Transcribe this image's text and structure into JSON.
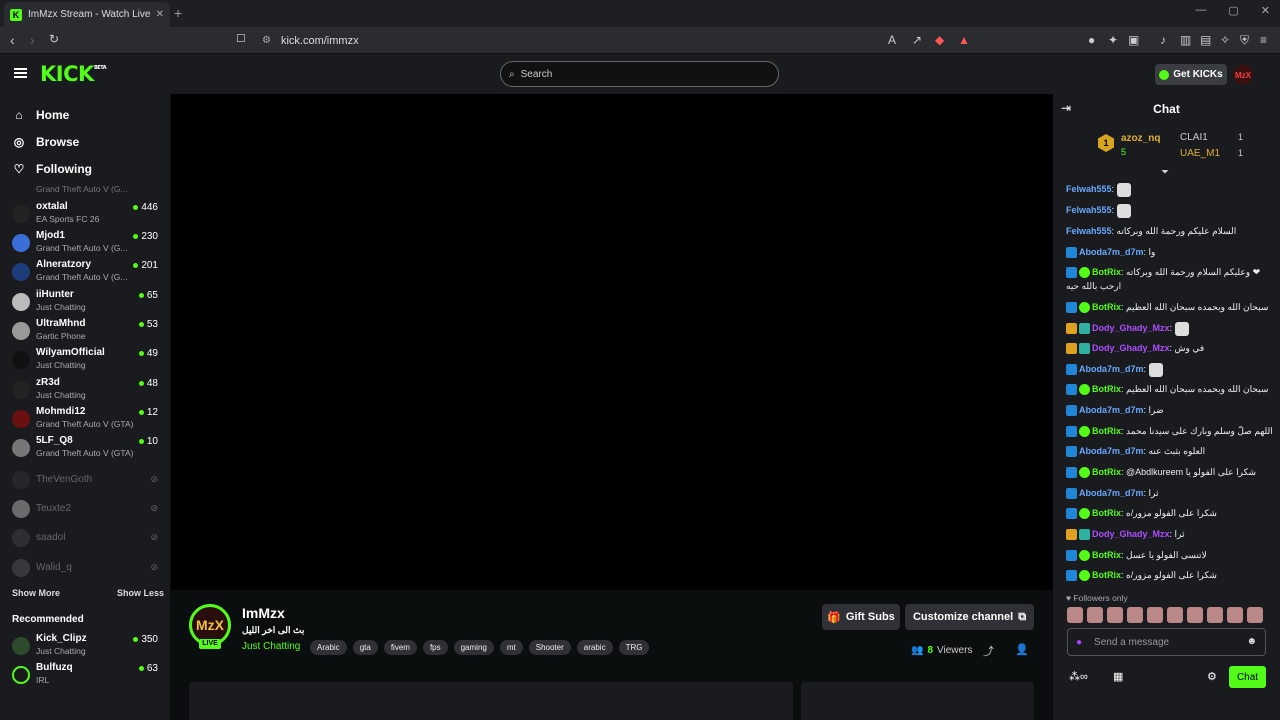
{
  "browser": {
    "tab_title": "ImMzx Stream - Watch Live on K",
    "tab_favicon": "K",
    "new_tab": "+",
    "url": "kick.com/immzx"
  },
  "header": {
    "logo": "KICK",
    "logo_badge": "BETA",
    "search_placeholder": "Search",
    "get_kicks": "Get KICKs",
    "user_avatar": "MzX"
  },
  "sidebar": {
    "nav": [
      {
        "label": "Home",
        "icon": "home-icon"
      },
      {
        "label": "Browse",
        "icon": "compass-icon"
      },
      {
        "label": "Following",
        "icon": "heart-icon"
      }
    ],
    "partial_top": "Grand Theft Auto V (G...",
    "following": [
      {
        "name": "oxtalal",
        "game": "EA Sports FC 26",
        "viewers": "446"
      },
      {
        "name": "Mjod1",
        "game": "Grand Theft Auto V (G...",
        "viewers": "230"
      },
      {
        "name": "Alneratzory",
        "game": "Grand Theft Auto V (G...",
        "viewers": "201"
      },
      {
        "name": "iiHunter",
        "game": "Just Chatting",
        "viewers": "65"
      },
      {
        "name": "UltraMhnd",
        "game": "Gartic Phone",
        "viewers": "53"
      },
      {
        "name": "WilyamOfficial",
        "game": "Just Chatting",
        "viewers": "49"
      },
      {
        "name": "zR3d",
        "game": "Just Chatting",
        "viewers": "48"
      },
      {
        "name": "Mohmdi12",
        "game": "Grand Theft Auto V (GTA)",
        "viewers": "12"
      },
      {
        "name": "5LF_Q8",
        "game": "Grand Theft Auto V (GTA)",
        "viewers": "10"
      }
    ],
    "offline": [
      "TheVenGoth",
      "Teuxte2",
      "saadol",
      "Walid_q"
    ],
    "show_more": "Show More",
    "show_less": "Show Less",
    "recommended_title": "Recommended",
    "recommended": [
      {
        "name": "Kick_Clipz",
        "game": "Just Chatting",
        "viewers": "350"
      },
      {
        "name": "Bulfuzq",
        "game": "IRL",
        "viewers": "63"
      }
    ]
  },
  "channel": {
    "avatar": "MzX",
    "live_label": "LIVE",
    "name": "ImMzx",
    "title": "بث الى اخر الليل",
    "category": "Just Chatting",
    "tags": [
      "Arabic",
      "gta",
      "fivem",
      "fps",
      "gaming",
      "mt",
      "Shooter",
      "arabic",
      "TRG"
    ],
    "gift_subs": "Gift Subs",
    "customize": "Customize channel",
    "viewer_count": "8",
    "viewers_label": "Viewers"
  },
  "chat": {
    "title": "Chat",
    "leaderboard": {
      "rank1_badge": "1",
      "top_user": "azoz_nq",
      "top_count": "5",
      "second_user": "CLAI1",
      "second_count": "1",
      "third_user": "UAE_M1",
      "third_count": "1"
    },
    "messages": [
      {
        "user": "Felwah555",
        "color": "#6aa8ff",
        "text": ":",
        "badges": [],
        "emote": true
      },
      {
        "user": "Felwah555",
        "color": "#6aa8ff",
        "text": ":",
        "badges": [],
        "emote": true
      },
      {
        "user": "Felwah555",
        "color": "#6aa8ff",
        "text": ": السلام عليكم ورحمة الله وبركاته",
        "badges": []
      },
      {
        "user": "Aboda7m_d7m",
        "color": "#6aa8ff",
        "text": ": وا",
        "badges": [
          "mod"
        ]
      },
      {
        "user": "BotRix",
        "color": "#53fc18",
        "text": ": وعليكم السلام ورحمة الله وبركاته ❤",
        "badges": [
          "mod",
          "ver"
        ]
      },
      {
        "user": "",
        "color": "#eee",
        "text": "ارحب بالله حيه",
        "badges": []
      },
      {
        "user": "BotRix",
        "color": "#53fc18",
        "text": ": سبحان الله وبحمده سبحان الله العظيم",
        "badges": [
          "mod",
          "ver"
        ]
      },
      {
        "user": "Dody_Ghady_Mzx",
        "color": "#b04cff",
        "text": ":",
        "badges": [
          "crown",
          "sub"
        ],
        "emote": true
      },
      {
        "user": "Dody_Ghady_Mzx",
        "color": "#b04cff",
        "text": ": في وش",
        "badges": [
          "crown",
          "sub"
        ]
      },
      {
        "user": "Aboda7m_d7m",
        "color": "#6aa8ff",
        "text": ":",
        "badges": [
          "mod"
        ],
        "emote": true
      },
      {
        "user": "BotRix",
        "color": "#53fc18",
        "text": ": سبحان الله وبحمده سبحان الله العظيم",
        "badges": [
          "mod",
          "ver"
        ]
      },
      {
        "user": "Aboda7m_d7m",
        "color": "#6aa8ff",
        "text": ": ضرا",
        "badges": [
          "mod"
        ]
      },
      {
        "user": "BotRix",
        "color": "#53fc18",
        "text": ": اللهم صلّ وسلم وبارك على سيدنا محمد",
        "badges": [
          "mod",
          "ver"
        ]
      },
      {
        "user": "Aboda7m_d7m",
        "color": "#6aa8ff",
        "text": ": العلوه بثبث عنه",
        "badges": [
          "mod"
        ]
      },
      {
        "user": "BotRix",
        "color": "#53fc18",
        "text": ": @Abdlkureem شكرا على الفولو يا",
        "badges": [
          "mod",
          "ver"
        ]
      },
      {
        "user": "Aboda7m_d7m",
        "color": "#6aa8ff",
        "text": ": ثرا",
        "badges": [
          "mod"
        ]
      },
      {
        "user": "BotRix",
        "color": "#53fc18",
        "text": ": شكرا على الفولو مزور/ه",
        "badges": [
          "mod",
          "ver"
        ]
      },
      {
        "user": "Dody_Ghady_Mzx",
        "color": "#b04cff",
        "text": ": ثرا",
        "badges": [
          "crown",
          "sub"
        ]
      },
      {
        "user": "BotRix",
        "color": "#53fc18",
        "text": ": لاتنسى الفولو يا عسل",
        "badges": [
          "mod",
          "ver"
        ]
      },
      {
        "user": "BotRix",
        "color": "#53fc18",
        "text": ": شكرا على الفولو مزور/ه",
        "badges": [
          "mod",
          "ver"
        ]
      }
    ],
    "followers_only": "Followers only",
    "input_placeholder": "Send a message",
    "chat_button": "Chat"
  }
}
